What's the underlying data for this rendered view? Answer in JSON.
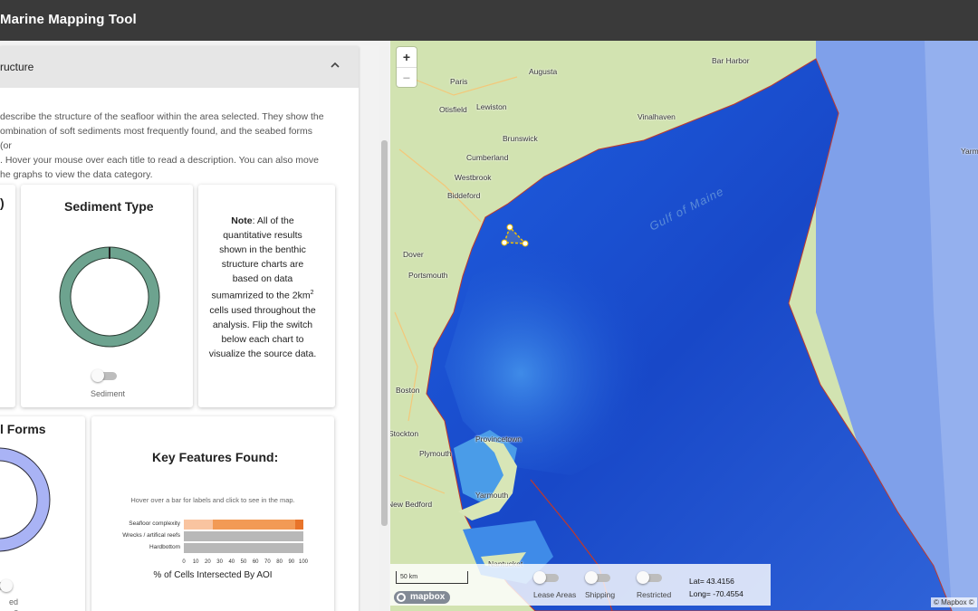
{
  "app": {
    "title": "Marine Mapping Tool"
  },
  "accordion": {
    "header_label": "ructure"
  },
  "intro_lines": [
    "describe the structure of the seafloor within the area selected. They show the",
    "ombination of soft sediments most frequently found, and the seabed forms (or",
    ". Hover your mouse over each title to read a description. You can also move",
    "he graphs to view the data category."
  ],
  "cards": {
    "left_partial_title": ")",
    "sediment": {
      "title": "Sediment Type",
      "toggle_label": "Sediment",
      "donut_color": "#6da38f"
    },
    "note": {
      "bold": "Note",
      "text": ": All of the quantitative results shown in the benthic structure charts are based on data sumamrized to the 2km",
      "sup": "2",
      "text2": " cells used throughout the analysis. Flip the switch below each chart to visualize the source data."
    },
    "forms": {
      "title": "l Forms",
      "toggle_label_1": "ed",
      "toggle_label_2": "s",
      "donut_color": "#a9b3f5"
    },
    "key_features": {
      "title": "Key Features Found:",
      "hint": "Hover over a bar for labels and click to see in the map.",
      "axis_label": "% of Cells Intersected By AOI",
      "axis_ticks": [
        "0",
        "10",
        "20",
        "30",
        "40",
        "50",
        "60",
        "70",
        "80",
        "90",
        "100"
      ]
    }
  },
  "chart_data": {
    "type": "bar",
    "orientation": "horizontal",
    "categories": [
      "Seafloor complexity",
      "Wrecks / artifical reefs",
      "Hardbottom"
    ],
    "series": [
      {
        "color": "#f9c4a0",
        "values": [
          24,
          0,
          0
        ]
      },
      {
        "color": "#f29a55",
        "values": [
          69,
          0,
          0
        ]
      },
      {
        "color": "#e8742a",
        "values": [
          7,
          0,
          0
        ]
      },
      {
        "color": "#b8b8b8",
        "values": [
          0,
          100,
          100
        ]
      }
    ],
    "xlabel": "% of Cells Intersected By AOI",
    "xlim": [
      0,
      100
    ]
  },
  "map": {
    "zoom_in": "+",
    "zoom_out": "−",
    "labels": [
      "Augusta",
      "Paris",
      "Lewiston",
      "Otisfield",
      "Brunswick",
      "Cumberland",
      "Westbrook",
      "Biddeford",
      "Dover",
      "Portsmouth",
      "Boston",
      "Plymouth",
      "Provincetown",
      "Yarmouth",
      "Nantucket",
      "New Bedford",
      "Stockton",
      "Bar Harbor",
      "Vinalhaven",
      "Yarm"
    ],
    "gulf_label": "Gulf of Maine",
    "scale": "50 km",
    "mapbox": "mapbox",
    "attribution": "© Mapbox ©",
    "layers": [
      "Lease Areas",
      "Shipping",
      "Restricted"
    ],
    "lat": "Lat= 43.4156",
    "long": "Long= -70.4554"
  }
}
